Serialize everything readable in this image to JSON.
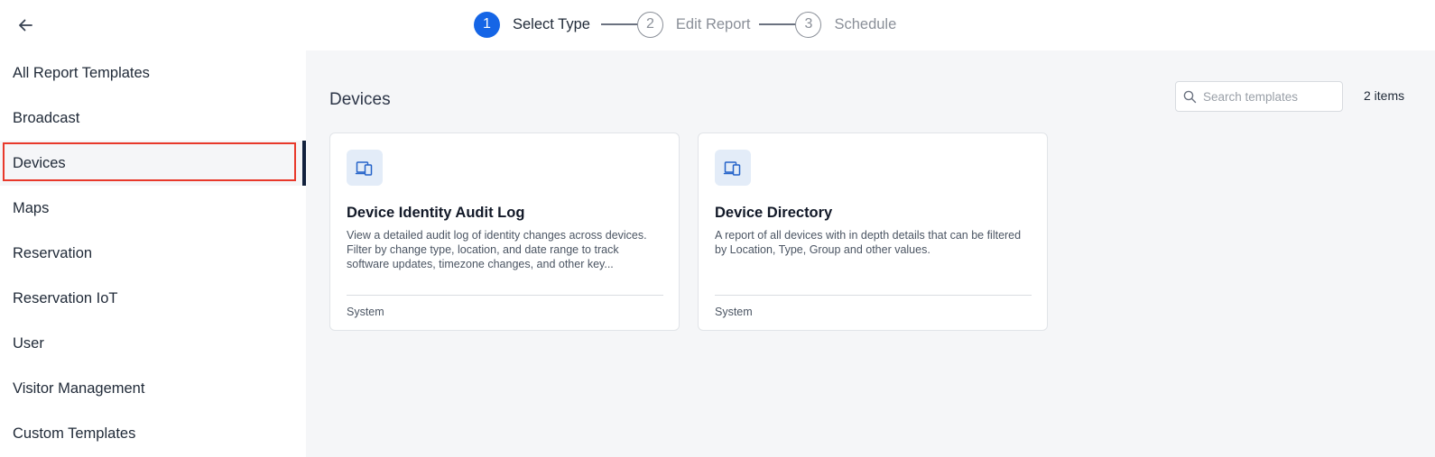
{
  "header": {
    "back_label": "Back",
    "steps": [
      {
        "number": "1",
        "label": "Select Type",
        "state": "active"
      },
      {
        "number": "2",
        "label": "Edit Report",
        "state": "inactive"
      },
      {
        "number": "3",
        "label": "Schedule",
        "state": "inactive"
      }
    ]
  },
  "sidebar": {
    "items": [
      {
        "label": "All Report Templates"
      },
      {
        "label": "Broadcast"
      },
      {
        "label": "Devices",
        "selected": true
      },
      {
        "label": "Maps"
      },
      {
        "label": "Reservation"
      },
      {
        "label": "Reservation IoT"
      },
      {
        "label": "User"
      },
      {
        "label": "Visitor Management"
      },
      {
        "label": "Custom Templates"
      }
    ]
  },
  "main": {
    "section_title": "Devices",
    "search": {
      "placeholder": "Search templates",
      "value": ""
    },
    "item_count": "2 items",
    "cards": [
      {
        "icon": "devices-icon",
        "title": "Device Identity Audit Log",
        "description": "View a detailed audit log of identity changes across devices. Filter by change type, location, and date range to track software updates, timezone changes, and other key...",
        "footer": "System"
      },
      {
        "icon": "devices-icon",
        "title": "Device Directory",
        "description": "A report of all devices with in depth details that can be filtered by Location, Type, Group and other values.",
        "footer": "System"
      }
    ]
  },
  "colors": {
    "accent": "#1565e6",
    "selected_bar": "#12213d",
    "highlight": "#e8392b",
    "main_bg": "#f5f6f8",
    "icon_bg": "#e3ecf8"
  }
}
